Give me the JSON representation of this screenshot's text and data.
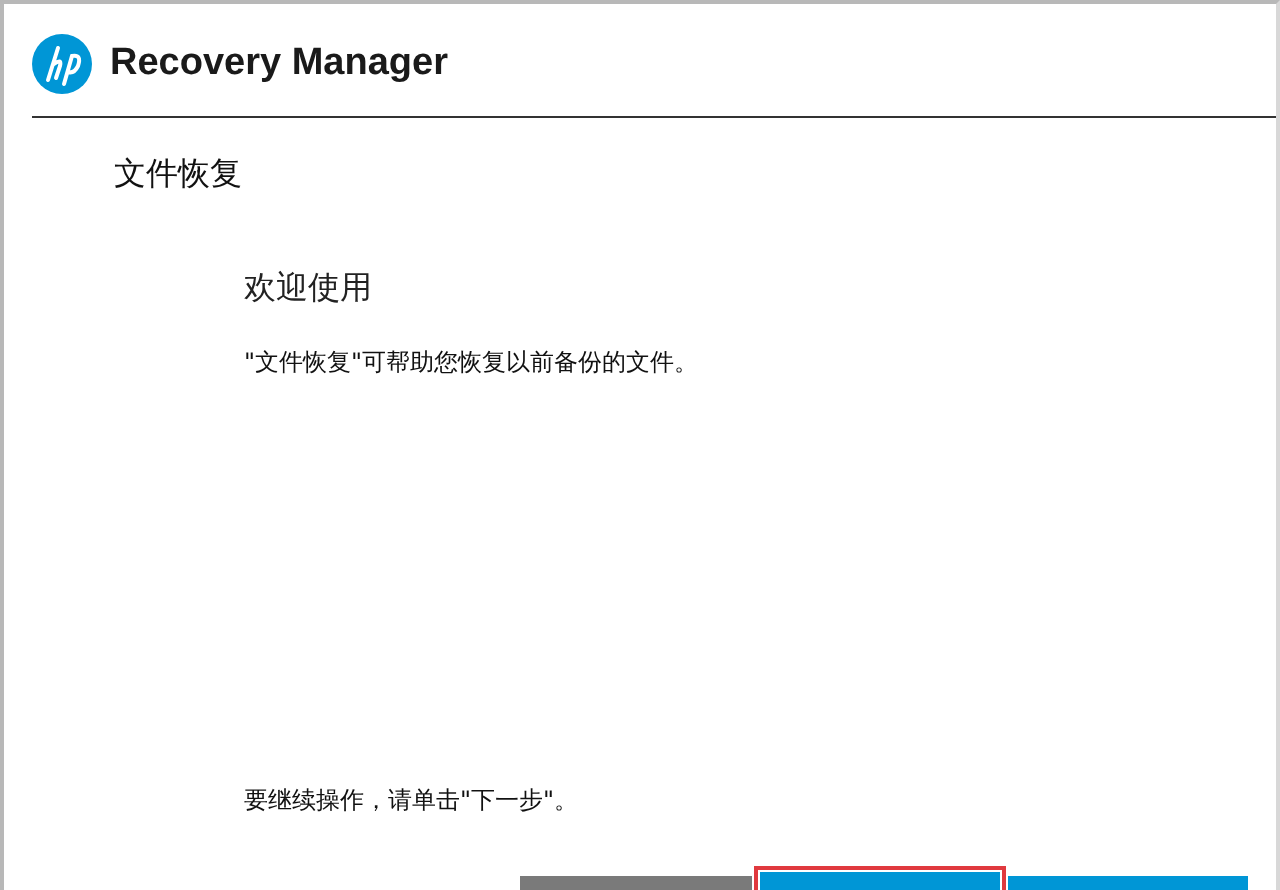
{
  "window": {
    "title": "Recovery Manager"
  },
  "section_title": "文件恢复",
  "heading": "欢迎使用",
  "description": "\"文件恢复\"可帮助您恢复以前备份的文件。",
  "instruction": "要继续操作，请单击\"下一步\"。",
  "buttons": [
    {
      "kind": "secondary",
      "focused": false
    },
    {
      "kind": "primary",
      "focused": true
    },
    {
      "kind": "primary",
      "focused": false
    }
  ]
}
